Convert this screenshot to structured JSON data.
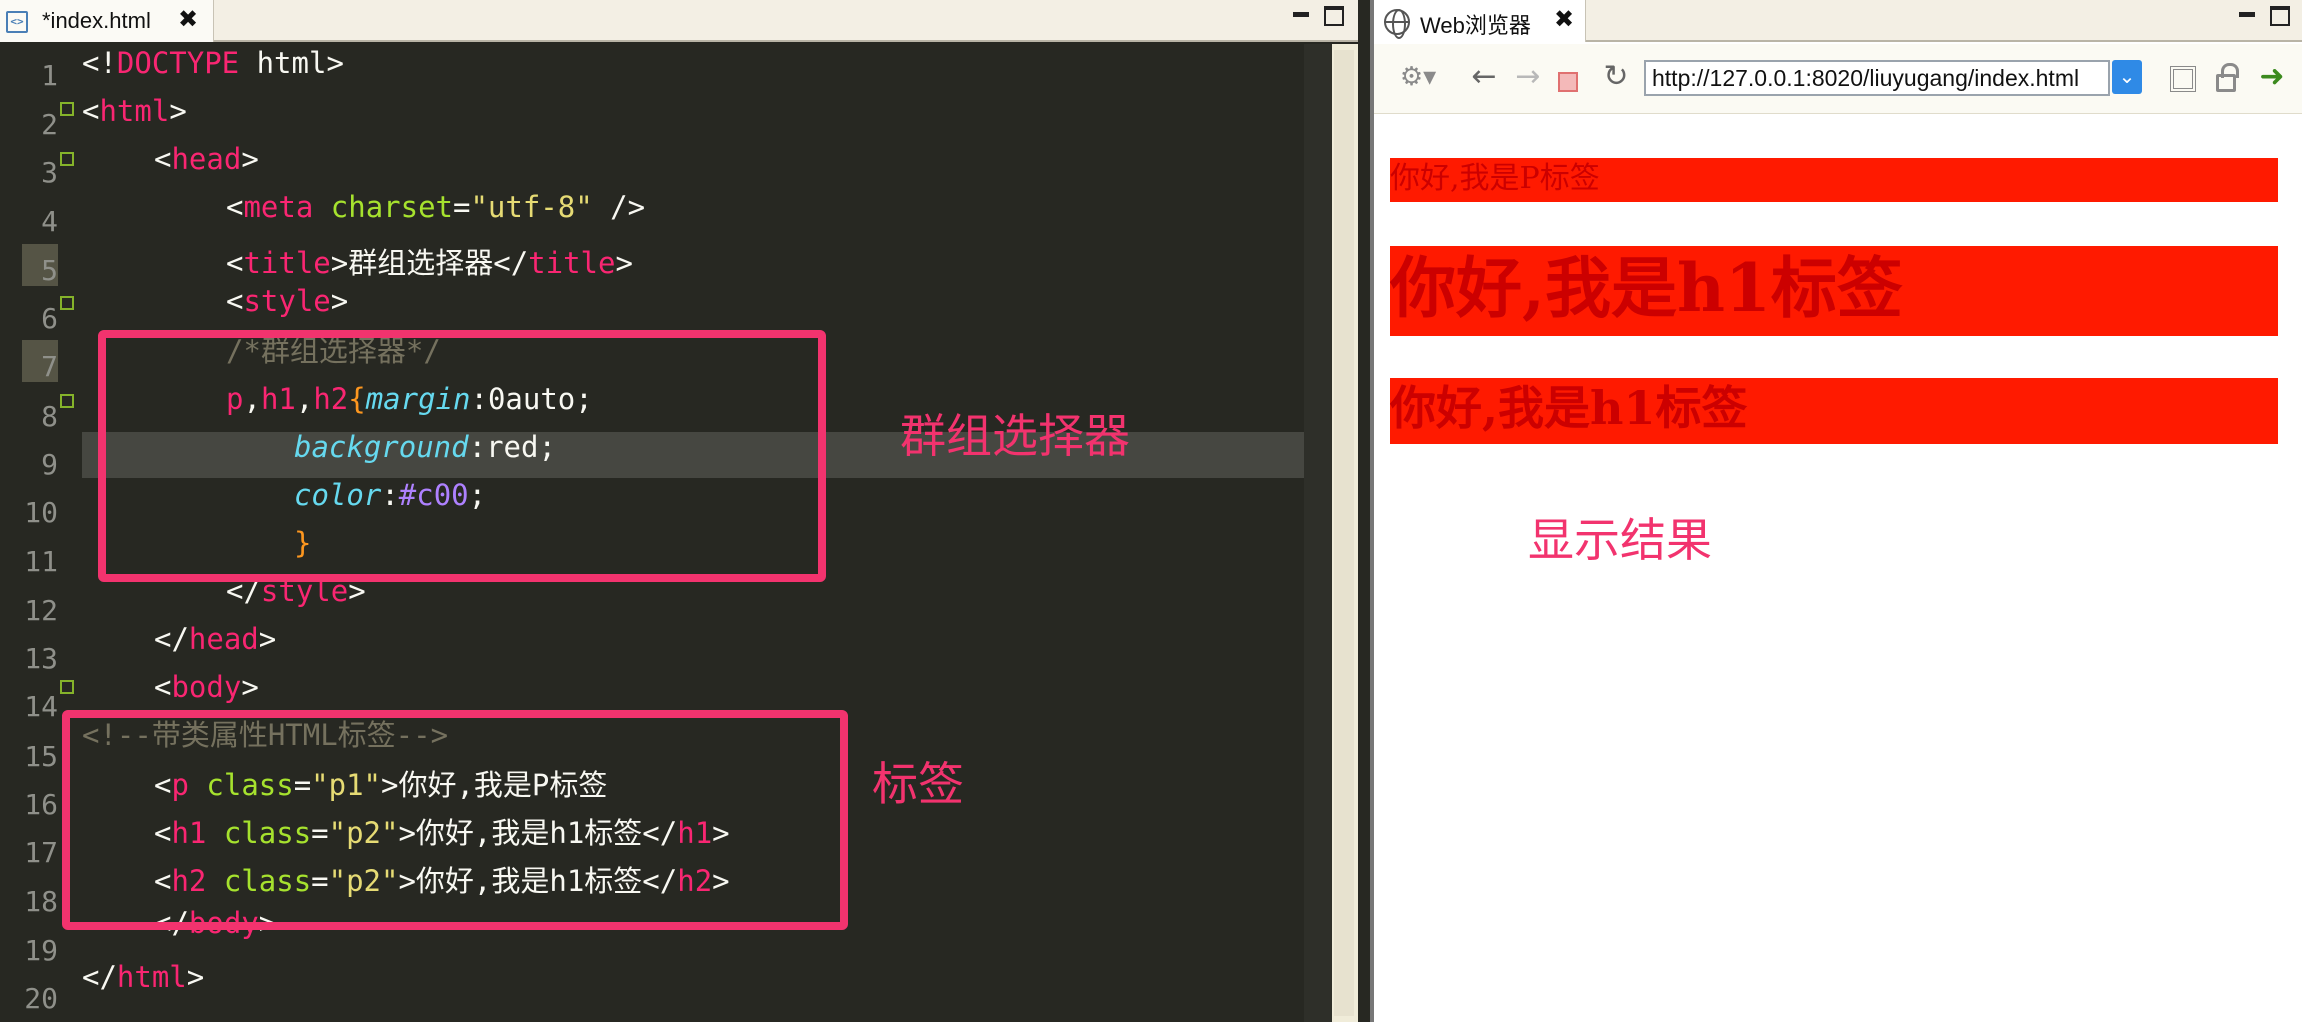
{
  "editor": {
    "tab_title": "*index.html",
    "tab_close": "✖",
    "line_numbers": [
      "1",
      "2",
      "3",
      "4",
      "5",
      "6",
      "7",
      "8",
      "9",
      "10",
      "11",
      "12",
      "13",
      "14",
      "15",
      "16",
      "17",
      "18",
      "19",
      "20"
    ]
  },
  "code": {
    "l1": {
      "a": "<!",
      "b": "DOCTYPE",
      "c": " html>"
    },
    "l2": {
      "a": "<",
      "b": "html",
      "c": ">"
    },
    "l3": {
      "a": "<",
      "b": "head",
      "c": ">"
    },
    "l4": {
      "a": "<",
      "b": "meta",
      "c": " charset",
      "d": "=",
      "e": "\"utf-8\"",
      "f": " />"
    },
    "l5": {
      "a": "<",
      "b": "title",
      "c": ">群组选择器</",
      "d": "title",
      "e": ">"
    },
    "l6": {
      "a": "<",
      "b": "style",
      "c": ">"
    },
    "l7": {
      "a": "/*群组选择器*/"
    },
    "l8": {
      "a": "p",
      "b": ",",
      "c": "h1",
      "d": ",",
      "e": "h2",
      "f": "{",
      "g": "margin",
      "h": ":0auto;"
    },
    "l9": {
      "a": "background",
      "b": ":red;"
    },
    "l10": {
      "a": "color",
      "b": ":",
      "c": "#c00",
      "d": ";"
    },
    "l11": {
      "a": "}"
    },
    "l12": {
      "a": "</",
      "b": "style",
      "c": ">"
    },
    "l13": {
      "a": "</",
      "b": "head",
      "c": ">"
    },
    "l14": {
      "a": "<",
      "b": "body",
      "c": ">"
    },
    "l15": {
      "a": "<!--带类属性HTML标签-->"
    },
    "l16": {
      "a": "<",
      "b": "p",
      "c": " class",
      "d": "=",
      "e": "\"p1\"",
      "f": ">你好,我是P标签"
    },
    "l17": {
      "a": "<",
      "b": "h1",
      "c": " class",
      "d": "=",
      "e": "\"p2\"",
      "f": ">你好,我是h1标签</",
      "g": "h1",
      "h": ">"
    },
    "l18": {
      "a": "<",
      "b": "h2",
      "c": " class",
      "d": "=",
      "e": "\"p2\"",
      "f": ">你好,我是h1标签</",
      "g": "h2",
      "h": ">"
    },
    "l19": {
      "a": "</",
      "b": "body",
      "c": ">"
    },
    "l20": {
      "a": "</",
      "b": "html",
      "c": ">"
    }
  },
  "annotations": {
    "group_selector": "群组选择器",
    "tags": "标签",
    "result": "显示结果",
    "accent_color": "#f2336e"
  },
  "browser": {
    "tab_title": "Web浏览器",
    "tab_close": "✖",
    "url": "http://127.0.0.1:8020/liuyugang/index.html",
    "settings_glyph": "⚙▾",
    "back_glyph": "←",
    "forward_glyph": "→",
    "refresh_glyph": "↻",
    "go_glyph": "➜",
    "dropdown_glyph": "⌄"
  },
  "output": {
    "p_text": "你好,我是P标签",
    "h1_text": "你好,我是h1标签",
    "h2_text": "你好,我是h1标签",
    "background_color": "#ff1a00",
    "text_color": "#cc0000"
  }
}
